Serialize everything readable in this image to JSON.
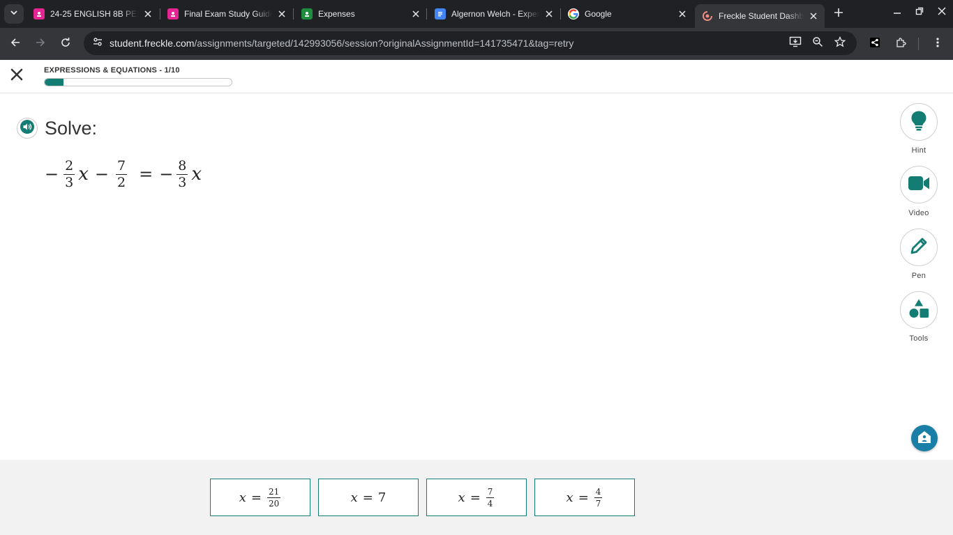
{
  "browser": {
    "tabs": [
      {
        "title": "24-25 ENGLISH 8B PER",
        "icon": "classroom-icon",
        "color": "#e52592"
      },
      {
        "title": "Final Exam Study Guide",
        "icon": "classroom-icon",
        "color": "#e52592"
      },
      {
        "title": "Expenses",
        "icon": "classroom-icon",
        "color": "#1e8e3e"
      },
      {
        "title": "Algernon Welch - Expenses",
        "icon": "docs-icon",
        "color": "#4285f4"
      },
      {
        "title": "Google",
        "icon": "google-icon",
        "color": "#ffffff"
      },
      {
        "title": "Freckle Student Dashboard",
        "icon": "freckle-icon",
        "color": "#f28b82",
        "active": true
      }
    ],
    "url_host": "student.freckle.com",
    "url_path": "/assignments/targeted/142993056/session?originalAssignmentId=141735471&tag=retry"
  },
  "header": {
    "section_title": "EXPRESSIONS & EQUATIONS - 1/10",
    "progress": 0.1,
    "accent_color": "#137d74"
  },
  "question": {
    "prompt": "Solve:",
    "equation": {
      "lhs_sign": "−",
      "term1": {
        "num": "2",
        "den": "3",
        "var": "x"
      },
      "op": "−",
      "term2": {
        "num": "7",
        "den": "2"
      },
      "equals": "=",
      "rhs_sign": "−",
      "term3": {
        "num": "8",
        "den": "3",
        "var": "x"
      }
    }
  },
  "tools": [
    {
      "label": "Hint",
      "icon": "lightbulb-icon"
    },
    {
      "label": "Video",
      "icon": "video-camera-icon"
    },
    {
      "label": "Pen",
      "icon": "pencil-icon"
    },
    {
      "label": "Tools",
      "icon": "shapes-icon"
    }
  ],
  "answers": [
    {
      "var": "x",
      "equals": "=",
      "num": "21",
      "den": "20"
    },
    {
      "var": "x",
      "equals": "=",
      "value": "7"
    },
    {
      "var": "x",
      "equals": "=",
      "num": "7",
      "den": "4"
    },
    {
      "var": "x",
      "equals": "=",
      "num": "4",
      "den": "7"
    }
  ]
}
